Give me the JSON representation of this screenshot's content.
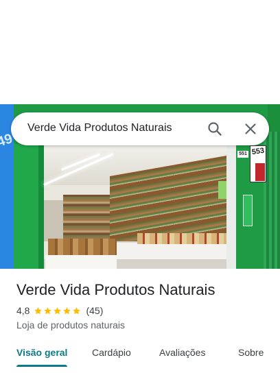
{
  "search": {
    "query": "Verde Vida Produtos Naturais"
  },
  "photo": {
    "storefront_numbers": [
      "49",
      "553",
      "551"
    ]
  },
  "place": {
    "name": "Verde Vida Produtos Naturais",
    "rating": "4,8",
    "stars": 5,
    "review_count": "(45)",
    "category": "Loja de produtos naturais"
  },
  "tabs": [
    {
      "label": "Visão geral",
      "active": true
    },
    {
      "label": "Cardápio",
      "active": false
    },
    {
      "label": "Avaliações",
      "active": false
    },
    {
      "label": "Sobre",
      "active": false
    }
  ],
  "colors": {
    "accent": "#0b7a86",
    "star": "#fbbc04"
  },
  "icons": [
    "search-icon",
    "close-icon",
    "star-icon"
  ]
}
